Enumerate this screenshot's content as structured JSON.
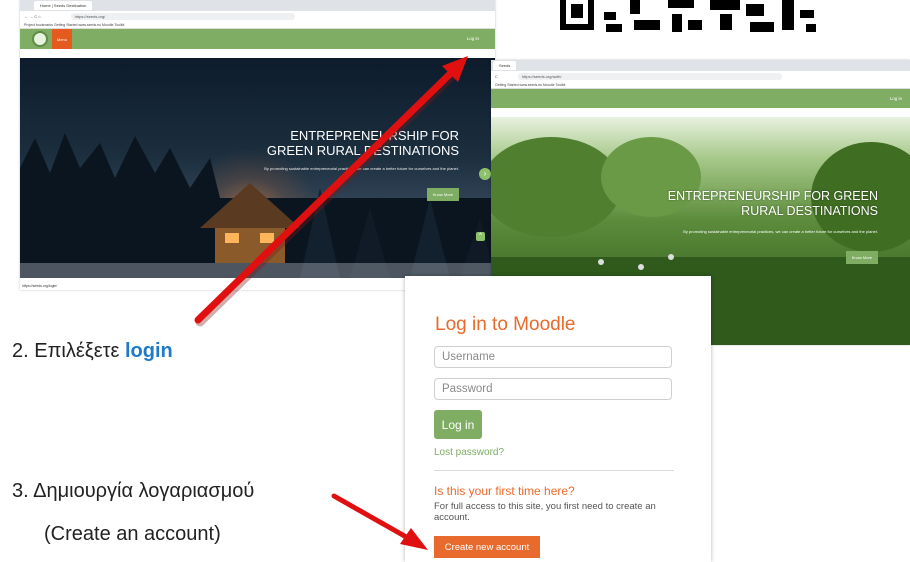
{
  "browser1": {
    "tab_title": "Home | Seeds Destination",
    "url": "https://seeds.org/",
    "bookmarks": "Project bookmarks  Getting Started  www.seeds.eu  Moodle Toolkit",
    "menu_label": "Menu",
    "login_label": "Log in",
    "hero_title": "ENTREPRENEURSHIP FOR GREEN RURAL DESTINATIONS",
    "hero_subtitle": "By promoting sustainable entrepreneurial practices, we can create a better future for ourselves and the planet.",
    "know_more": "Know More",
    "status_url": "https://seeds.org/login/"
  },
  "browser2": {
    "tab_title": "Seeds",
    "url": "https://seeds.org/auth/",
    "bookmarks": "Getting Started  www.seeds.eu  Moodle Toolkit",
    "login_label": "Log in",
    "hero_title": "ENTREPRENEURSHIP FOR GREEN RURAL DESTINATIONS",
    "hero_subtitle": "By promoting sustainable entrepreneurial practices, we can create a better future for ourselves and the planet.",
    "know_more": "Know More"
  },
  "login_card": {
    "title": "Log in to Moodle",
    "username_placeholder": "Username",
    "password_placeholder": "Password",
    "login_button": "Log in",
    "lost_password": "Lost password?",
    "first_time_heading": "Is this your first time here?",
    "first_time_text": "For full access to this site, you first need to create an account.",
    "create_account_button": "Create new account"
  },
  "instructions": {
    "step2_prefix": "2.  Επιλέξετε ",
    "step2_highlight": "login",
    "step3_line1": "3.  Δημιουργία λογαριασμού",
    "step3_line2": "(Create an account)"
  },
  "colors": {
    "brand_green": "#7fad64",
    "accent_orange": "#e86a2c",
    "arrow_red": "#e01010",
    "link_blue": "#1f7ac7"
  }
}
